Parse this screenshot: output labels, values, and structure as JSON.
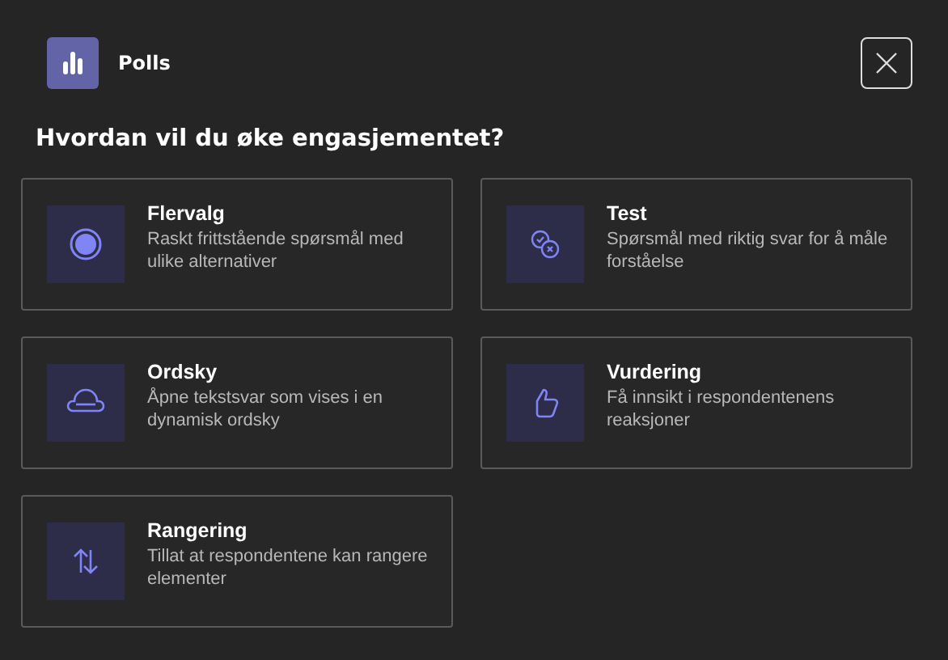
{
  "app": {
    "title": "Polls"
  },
  "heading": "Hvordan vil du øke engasjementet?",
  "options": [
    {
      "kind": "radio",
      "title": "Flervalg",
      "description": "Raskt frittstående spørsmål med ulike alternativer"
    },
    {
      "kind": "quiz",
      "title": "Test",
      "description": "Spørsmål med riktig svar for å måle forståelse"
    },
    {
      "kind": "cloud",
      "title": "Ordsky",
      "description": "Åpne tekstsvar som vises i en dynamisk ordsky"
    },
    {
      "kind": "thumb",
      "title": "Vurdering",
      "description": "Få innsikt i respondentenens reaksjoner"
    },
    {
      "kind": "sort",
      "title": "Rangering",
      "description": "Tillat at respondentene kan rangere elementer"
    }
  ]
}
